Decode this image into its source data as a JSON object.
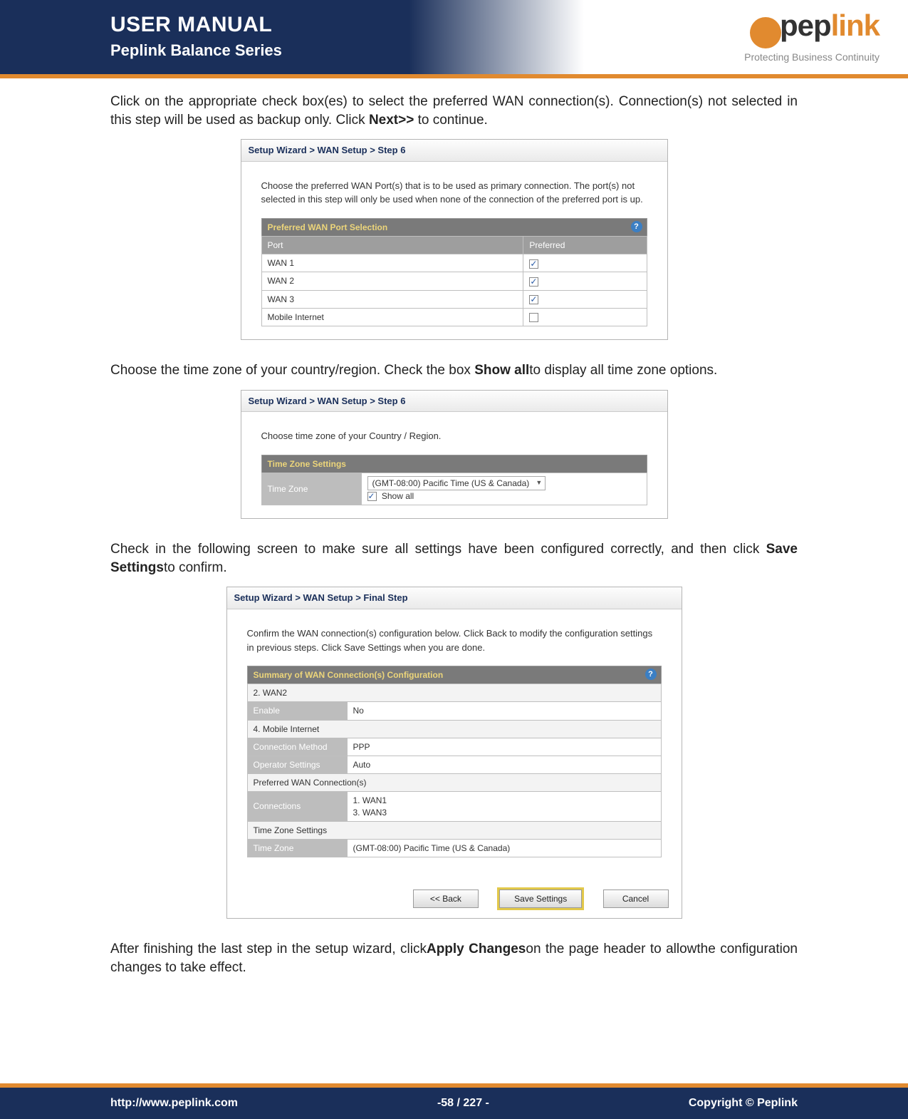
{
  "header": {
    "title": "USER MANUAL",
    "subtitle": "Peplink Balance Series",
    "brand": "peplink",
    "tagline": "Protecting Business Continuity"
  },
  "body": {
    "p1_a": "Click on the appropriate check box(es) to select the preferred WAN connection(s). Connection(s) not selected in this step will be used as backup only. Click ",
    "p1_bold": "Next>>",
    "p1_b": " to continue.",
    "p2_a": "Choose the time zone of your country/region. Check the box ",
    "p2_bold": "Show all",
    "p2_b": "to display all time zone options.",
    "p3_a": "Check in the following screen to make sure all settings have been configured correctly, and then click ",
    "p3_bold": "Save Settings",
    "p3_b": "to confirm.",
    "p4_a": "After finishing the last step in the setup wizard, click",
    "p4_bold": "Apply Changes",
    "p4_b": "on the page header to allowthe configuration changes to take effect."
  },
  "wiz1": {
    "bc": "Setup Wizard > WAN Setup > Step 6",
    "desc": "Choose the preferred WAN Port(s) that is to be used as primary connection. The port(s) not selected in this step will only be used when none of the connection of the preferred port is up.",
    "panel_title": "Preferred WAN Port Selection",
    "col1": "Port",
    "col2": "Preferred",
    "rows": [
      {
        "name": "WAN 1",
        "on": true
      },
      {
        "name": "WAN 2",
        "on": true
      },
      {
        "name": "WAN 3",
        "on": true
      },
      {
        "name": "Mobile Internet",
        "on": false
      }
    ]
  },
  "wiz2": {
    "bc": "Setup Wizard > WAN Setup > Step 6",
    "desc": "Choose time zone of your Country / Region.",
    "panel_title": "Time Zone Settings",
    "row_label": "Time Zone",
    "select_value": "(GMT-08:00) Pacific Time (US & Canada)",
    "showall_label": "Show all",
    "showall_on": true
  },
  "wiz3": {
    "bc": "Setup Wizard > WAN Setup > Final Step",
    "desc": "Confirm the WAN connection(s) configuration below. Click Back to modify the configuration settings in previous steps. Click Save Settings when you are done.",
    "panel_title": "Summary of WAN Connection(s) Configuration",
    "rows": {
      "s1": "2. WAN2",
      "enable_l": "Enable",
      "enable_v": "No",
      "s2": "4. Mobile Internet",
      "cm_l": "Connection Method",
      "cm_v": "PPP",
      "os_l": "Operator Settings",
      "os_v": "Auto",
      "s3": "Preferred WAN Connection(s)",
      "conn_l": "Connections",
      "conn_v": "1. WAN1\n3. WAN3",
      "s4": "Time Zone Settings",
      "tz_l": "Time Zone",
      "tz_v": "(GMT-08:00) Pacific Time (US & Canada)"
    },
    "buttons": {
      "back": "<< Back",
      "save": "Save Settings",
      "cancel": "Cancel"
    }
  },
  "footer": {
    "left": "http://www.peplink.com",
    "center": "-58 / 227 -",
    "right": "Copyright ©  Peplink"
  }
}
